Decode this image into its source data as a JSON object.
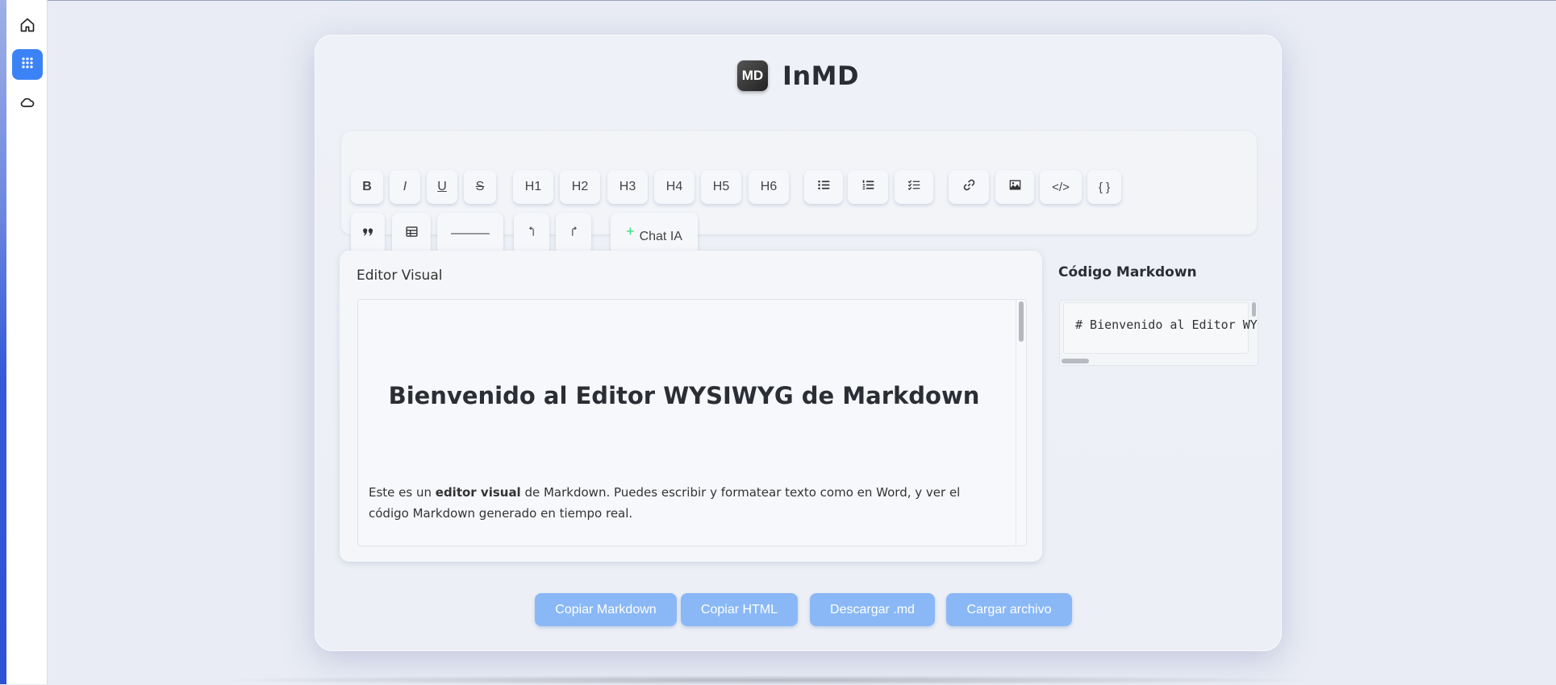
{
  "app": {
    "logo_text": "MD",
    "name": "InMD"
  },
  "dock": {
    "items": [
      {
        "icon": "home-icon",
        "active": false
      },
      {
        "icon": "apps-grid-icon",
        "active": true
      },
      {
        "icon": "cloud-icon",
        "active": false
      }
    ]
  },
  "toolbar": {
    "bold": "B",
    "italic": "I",
    "underline": "U",
    "strike": "S",
    "h1": "H1",
    "h2": "H2",
    "h3": "H3",
    "h4": "H4",
    "h5": "H5",
    "h6": "H6",
    "inline_code": "</>",
    "code_block": "{ }",
    "hr": "———",
    "ai_label": "Chat IA"
  },
  "editor": {
    "title": "Editor Visual",
    "heading": "Bienvenido al Editor WYSIWYG de Markdown",
    "para_before": "Este es un ",
    "para_bold": "editor visual",
    "para_after": " de Markdown. Puedes escribir y formatear texto como en Word, y ver el código Markdown generado en tiempo real."
  },
  "markdown": {
    "title": "Código Markdown",
    "code": "# Bienvenido al Editor WYSIWYG de Markdown"
  },
  "actions": {
    "copy_md": "Copiar Markdown",
    "copy_html": "Copiar HTML",
    "download": "Descargar .md",
    "load": "Cargar archivo"
  },
  "colors": {
    "accent": "#3b82f6",
    "action_button": "#8ab8f6",
    "ai_spark": "#3ddc84"
  }
}
